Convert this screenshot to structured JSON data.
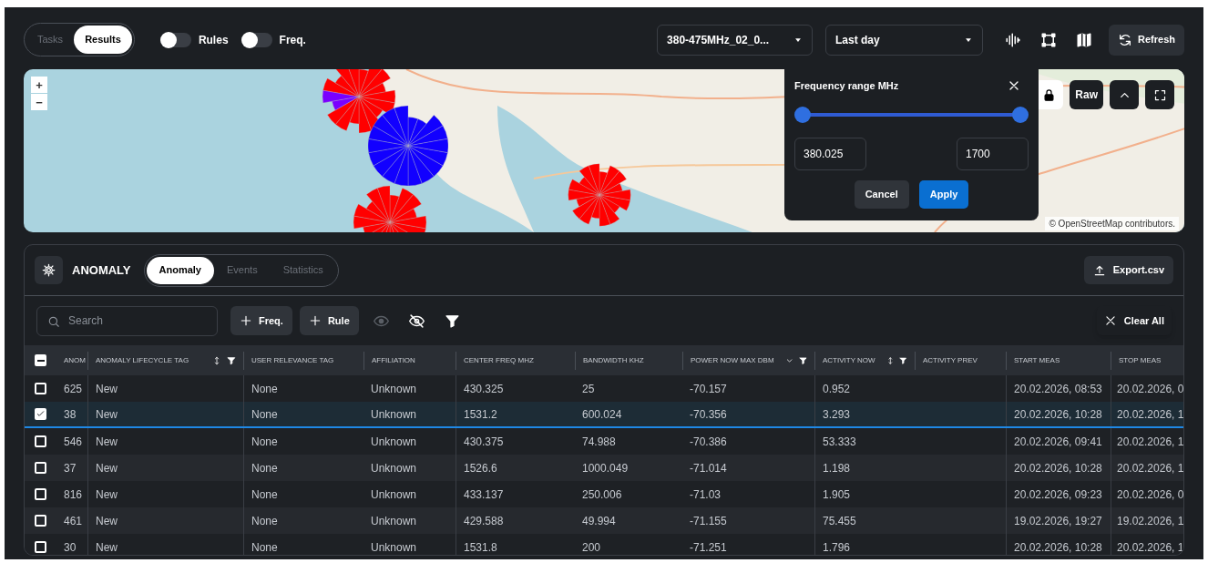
{
  "top_bar": {
    "mode_tabs": [
      {
        "label": "Tasks",
        "selected": false
      },
      {
        "label": "Results",
        "selected": true
      }
    ],
    "toggles": [
      {
        "label": "Rules",
        "on": false
      },
      {
        "label": "Freq.",
        "on": false
      }
    ],
    "dropdowns": [
      {
        "value": "380-475MHz_02_0..."
      },
      {
        "value": "Last day"
      }
    ],
    "tools": [
      {
        "kind": "waveform"
      },
      {
        "kind": "square"
      },
      {
        "kind": "map"
      }
    ],
    "refresh": {
      "label": "Refresh"
    }
  },
  "map": {
    "kind": "picture",
    "zoom": [
      "+",
      "−"
    ],
    "markers": [
      {
        "kind": "red-purple"
      },
      {
        "kind": "blue"
      },
      {
        "kind": "red-half"
      },
      {
        "kind": "red"
      }
    ],
    "controls": [
      {
        "kind": "lock",
        "selected": true
      },
      {
        "kind": "text",
        "label": "Raw",
        "selected": false
      },
      {
        "kind": "chevron-up",
        "selected": false
      },
      {
        "kind": "fullscreen",
        "selected": false
      }
    ],
    "attribution": "© OpenStreetMap contributors."
  },
  "frequency_popup": {
    "title": "Frequency range MHz",
    "thumbs": [
      {
        "level": 0
      },
      {
        "level": 1
      }
    ],
    "min_value": "380.025",
    "max_value": "1700",
    "buttons": [
      {
        "label": "Cancel",
        "kind": "secondary"
      },
      {
        "label": "Apply",
        "kind": "primary"
      }
    ]
  },
  "panel": {
    "title": "ANOMALY",
    "tabs": [
      {
        "label": "Anomaly",
        "selected": true
      },
      {
        "label": "Events",
        "selected": false
      },
      {
        "label": "Statistics",
        "selected": false
      }
    ],
    "export": "Export.csv",
    "search": {
      "placeholder": "Search"
    },
    "add_buttons": [
      "Freq.",
      "Rule"
    ],
    "view_icons": [
      {
        "kind": "eye",
        "disabled": true
      },
      {
        "kind": "eye-off",
        "disabled": false
      },
      {
        "kind": "filter",
        "disabled": false
      }
    ],
    "clear": "Clear All"
  },
  "table": {
    "header_checkbox": {
      "partial": true
    },
    "columns": [
      {
        "label": "ANOM",
        "kind": "plain"
      },
      {
        "label": "ANOMALY LIFECYCLE TAG",
        "kind": "sortfilter"
      },
      {
        "label": "USER RELEVANCE TAG",
        "kind": "plain"
      },
      {
        "label": "AFFILIATION",
        "kind": "plain"
      },
      {
        "label": "CENTER FREQ MHZ",
        "kind": "plain"
      },
      {
        "label": "BANDWIDTH KHZ",
        "kind": "plain"
      },
      {
        "label": "POWER NOW MAX DBM",
        "kind": "menufilter"
      },
      {
        "label": "ACTIVITY NOW",
        "kind": "sortfilter"
      },
      {
        "label": "ACTIVITY PREV",
        "kind": "plain"
      },
      {
        "label": "START MEAS",
        "kind": "plain"
      },
      {
        "label": "STOP MEAS",
        "kind": "plain"
      }
    ],
    "rows": [
      {
        "checked": false,
        "selected": false,
        "cells": [
          "625",
          "New",
          "None",
          "Unknown",
          "430.325",
          "25",
          "-70.157",
          "0.952",
          "",
          "20.02.2026, 08:53",
          "20.02.2026, 0"
        ]
      },
      {
        "checked": true,
        "selected": true,
        "cells": [
          "38",
          "New",
          "None",
          "Unknown",
          "1531.2",
          "600.024",
          "-70.356",
          "3.293",
          "",
          "20.02.2026, 10:28",
          "20.02.2026, 1"
        ]
      },
      {
        "checked": false,
        "selected": false,
        "cells": [
          "546",
          "New",
          "None",
          "Unknown",
          "430.375",
          "74.988",
          "-70.386",
          "53.333",
          "",
          "20.02.2026, 09:41",
          "20.02.2026, 1"
        ]
      },
      {
        "checked": false,
        "selected": false,
        "cells": [
          "37",
          "New",
          "None",
          "Unknown",
          "1526.6",
          "1000.049",
          "-71.014",
          "1.198",
          "",
          "20.02.2026, 10:28",
          "20.02.2026, 1"
        ]
      },
      {
        "checked": false,
        "selected": false,
        "cells": [
          "816",
          "New",
          "None",
          "Unknown",
          "433.137",
          "250.006",
          "-71.03",
          "1.905",
          "",
          "20.02.2026, 09:23",
          "20.02.2026, 0"
        ]
      },
      {
        "checked": false,
        "selected": false,
        "cells": [
          "461",
          "New",
          "None",
          "Unknown",
          "429.588",
          "49.994",
          "-71.155",
          "75.455",
          "",
          "19.02.2026, 19:27",
          "19.02.2026, 1"
        ]
      },
      {
        "checked": false,
        "selected": false,
        "cells": [
          "30",
          "New",
          "None",
          "Unknown",
          "1531.8",
          "200",
          "-71.251",
          "1.796",
          "",
          "20.02.2026, 10:28",
          "20.02.2026, 1"
        ]
      }
    ]
  }
}
